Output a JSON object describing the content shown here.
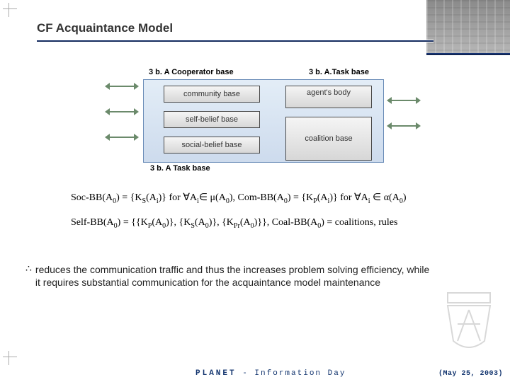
{
  "title": "CF Acquaintance Model",
  "diagram": {
    "labels": {
      "top_left": "3 b. A Cooperator base",
      "top_right": "3 b. A.Task base",
      "bottom": "3 b. A Task base"
    },
    "left_boxes": [
      "community base",
      "self-belief base",
      "social-belief base"
    ],
    "right_boxes_top": "agent's body",
    "right_boxes_bottom": "coalition base"
  },
  "formulas": {
    "line1_a": "Soc-BB(A",
    "line1_b": ") = {K",
    "line1_c": "(A",
    "line1_d": ")}  for ∀A",
    "line1_e": "∈ μ(A",
    "line1_f": "),  Com-BB(A",
    "line1_g": ") = {K",
    "line1_h": "(A",
    "line1_i": ")}  for ∀A",
    "line1_j": " ∈ α(A",
    "line1_k": ")",
    "line2_a": "Self-BB(A",
    "line2_b": ") =  {{K",
    "line2_c": "(A",
    "line2_d": ")}, {K",
    "line2_e": "(A",
    "line2_f": ")}, {K",
    "line2_g": "(A",
    "line2_h": ")}}, Coal-BB(A",
    "line2_i": ") = coalitions, rules"
  },
  "bullet": {
    "symbol": "∴",
    "text_parts": [
      "reduces the communication traffic and thus the increases problem solving efficiency, while it requires substantial communication for the acquaintance model maintenance"
    ]
  },
  "footer": {
    "left_a": "PLANET",
    "left_sep": " - ",
    "left_b": "Information Day",
    "right": "(May 25, 2003)"
  }
}
